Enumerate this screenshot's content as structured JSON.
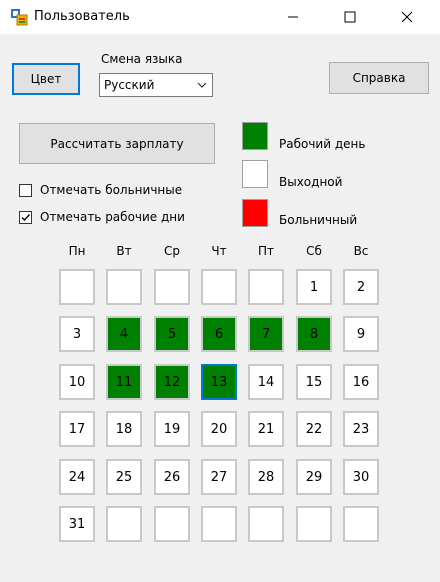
{
  "window": {
    "title": "Пользователь"
  },
  "buttons": {
    "color": "Цвет",
    "help": "Справка",
    "calc": "Рассчитать зарплату"
  },
  "language": {
    "label": "Смена языка",
    "selected": "Русский"
  },
  "checkboxes": [
    {
      "label": "Отмечать больничные",
      "checked": false
    },
    {
      "label": "Отмечать рабочие дни",
      "checked": true
    }
  ],
  "legend": [
    {
      "label": "Рабочий день",
      "color": "#008000"
    },
    {
      "label": "Выходной",
      "color": "#ffffff"
    },
    {
      "label": "Больничный",
      "color": "#ff0000"
    }
  ],
  "calendar": {
    "weekdays": [
      "Пн",
      "Вт",
      "Ср",
      "Чт",
      "Пт",
      "Сб",
      "Вс"
    ],
    "rows": [
      [
        "",
        "",
        "",
        "",
        "",
        "1",
        "2"
      ],
      [
        "3",
        "4",
        "5",
        "6",
        "7",
        "8",
        "9"
      ],
      [
        "10",
        "11",
        "12",
        "13",
        "14",
        "15",
        "16"
      ],
      [
        "17",
        "18",
        "19",
        "20",
        "21",
        "22",
        "23"
      ],
      [
        "24",
        "25",
        "26",
        "27",
        "28",
        "29",
        "30"
      ],
      [
        "31",
        "",
        "",
        "",
        "",
        "",
        ""
      ]
    ],
    "work_days": [
      "4",
      "5",
      "6",
      "7",
      "8",
      "11",
      "12",
      "13"
    ],
    "selected_day": "13"
  }
}
